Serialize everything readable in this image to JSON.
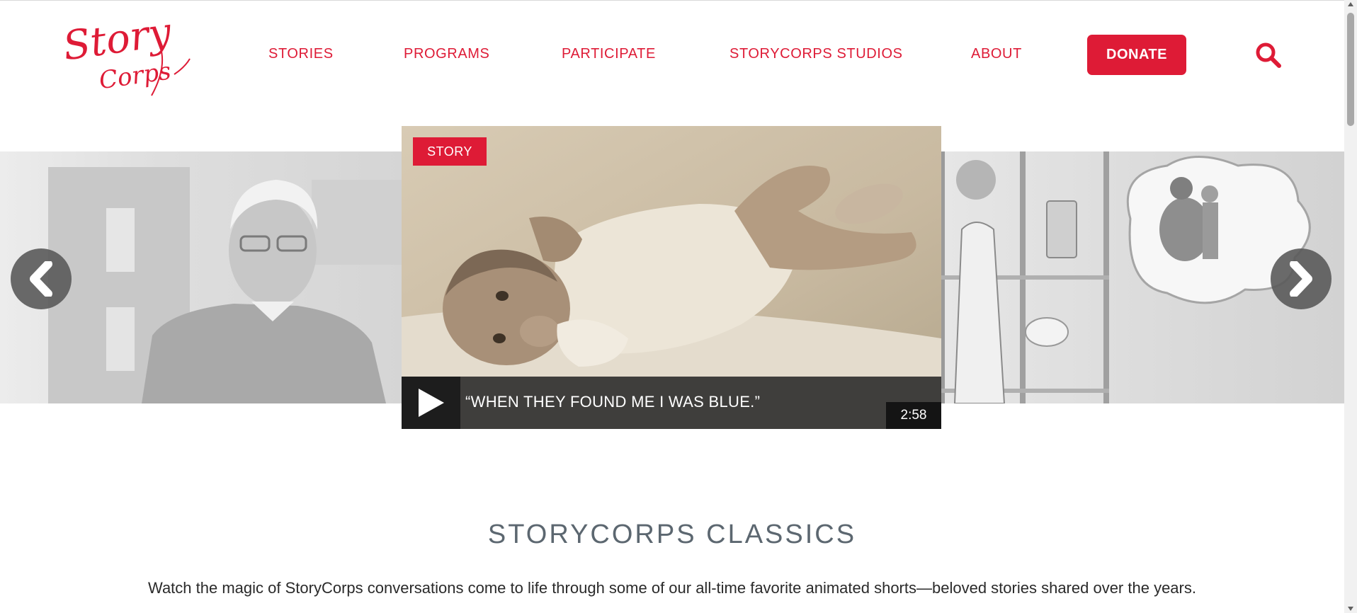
{
  "header": {
    "logo_line1": "Story",
    "logo_line2": "Corps",
    "nav": [
      {
        "label": "STORIES"
      },
      {
        "label": "PROGRAMS"
      },
      {
        "label": "PARTICIPATE"
      },
      {
        "label": "STORYCORPS STUDIOS"
      },
      {
        "label": "ABOUT"
      }
    ],
    "donate_label": "DONATE",
    "search_icon": "search-icon",
    "brand_color": "#de1b36"
  },
  "carousel": {
    "featured": {
      "tag": "STORY",
      "caption": "“WHEN THEY FOUND ME I WAS BLUE.”",
      "duration": "2:58"
    },
    "prev_icon": "chevron-left-icon",
    "next_icon": "chevron-right-icon"
  },
  "section": {
    "title": "STORYCORPS CLASSICS",
    "description": "Watch the magic of StoryCorps conversations come to life through some of our all-time favorite animated shorts—beloved stories shared over the years."
  }
}
